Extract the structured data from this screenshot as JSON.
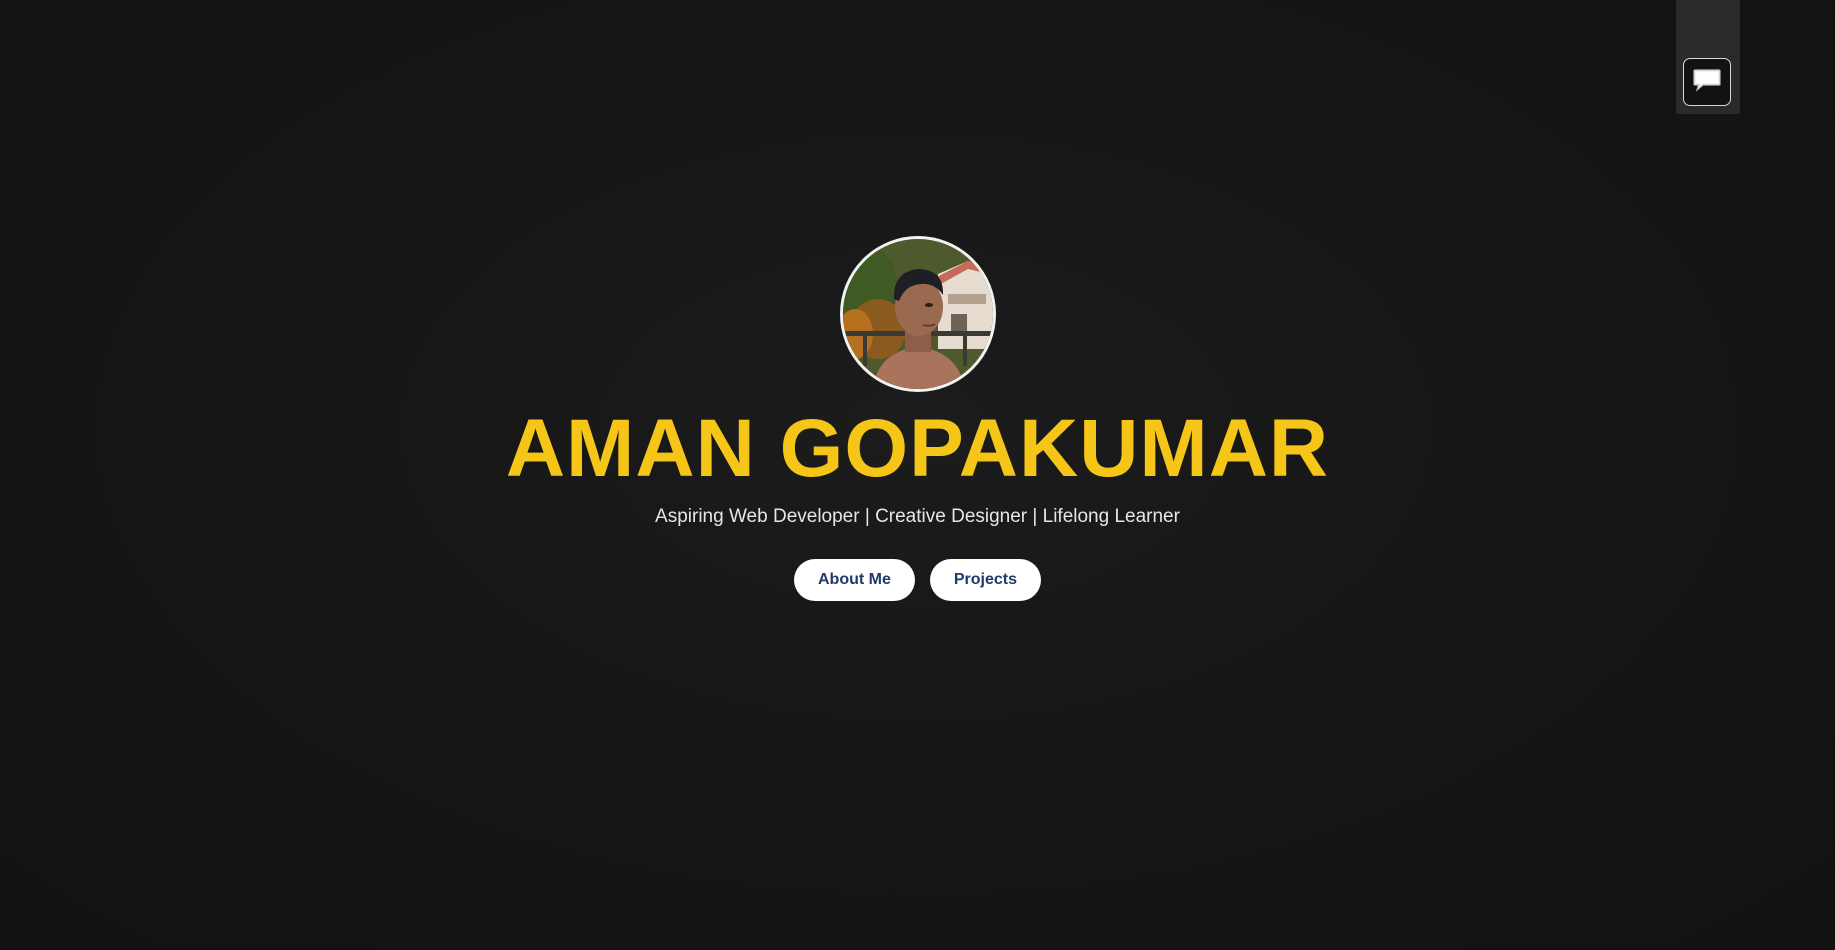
{
  "profile": {
    "name": "AMAN GOPAKUMAR",
    "tagline": "Aspiring Web Developer | Creative Designer | Lifelong Learner",
    "avatar_icon": "profile-photo"
  },
  "actions": {
    "about_label": "About Me",
    "projects_label": "Projects"
  },
  "chat": {
    "icon": "speech-bubble-icon"
  },
  "colors": {
    "background": "#141414",
    "name_accent": "#f5c518",
    "button_bg": "#ffffff",
    "button_text": "#1f3a6b",
    "chat_dock": "#2a2a2a"
  }
}
